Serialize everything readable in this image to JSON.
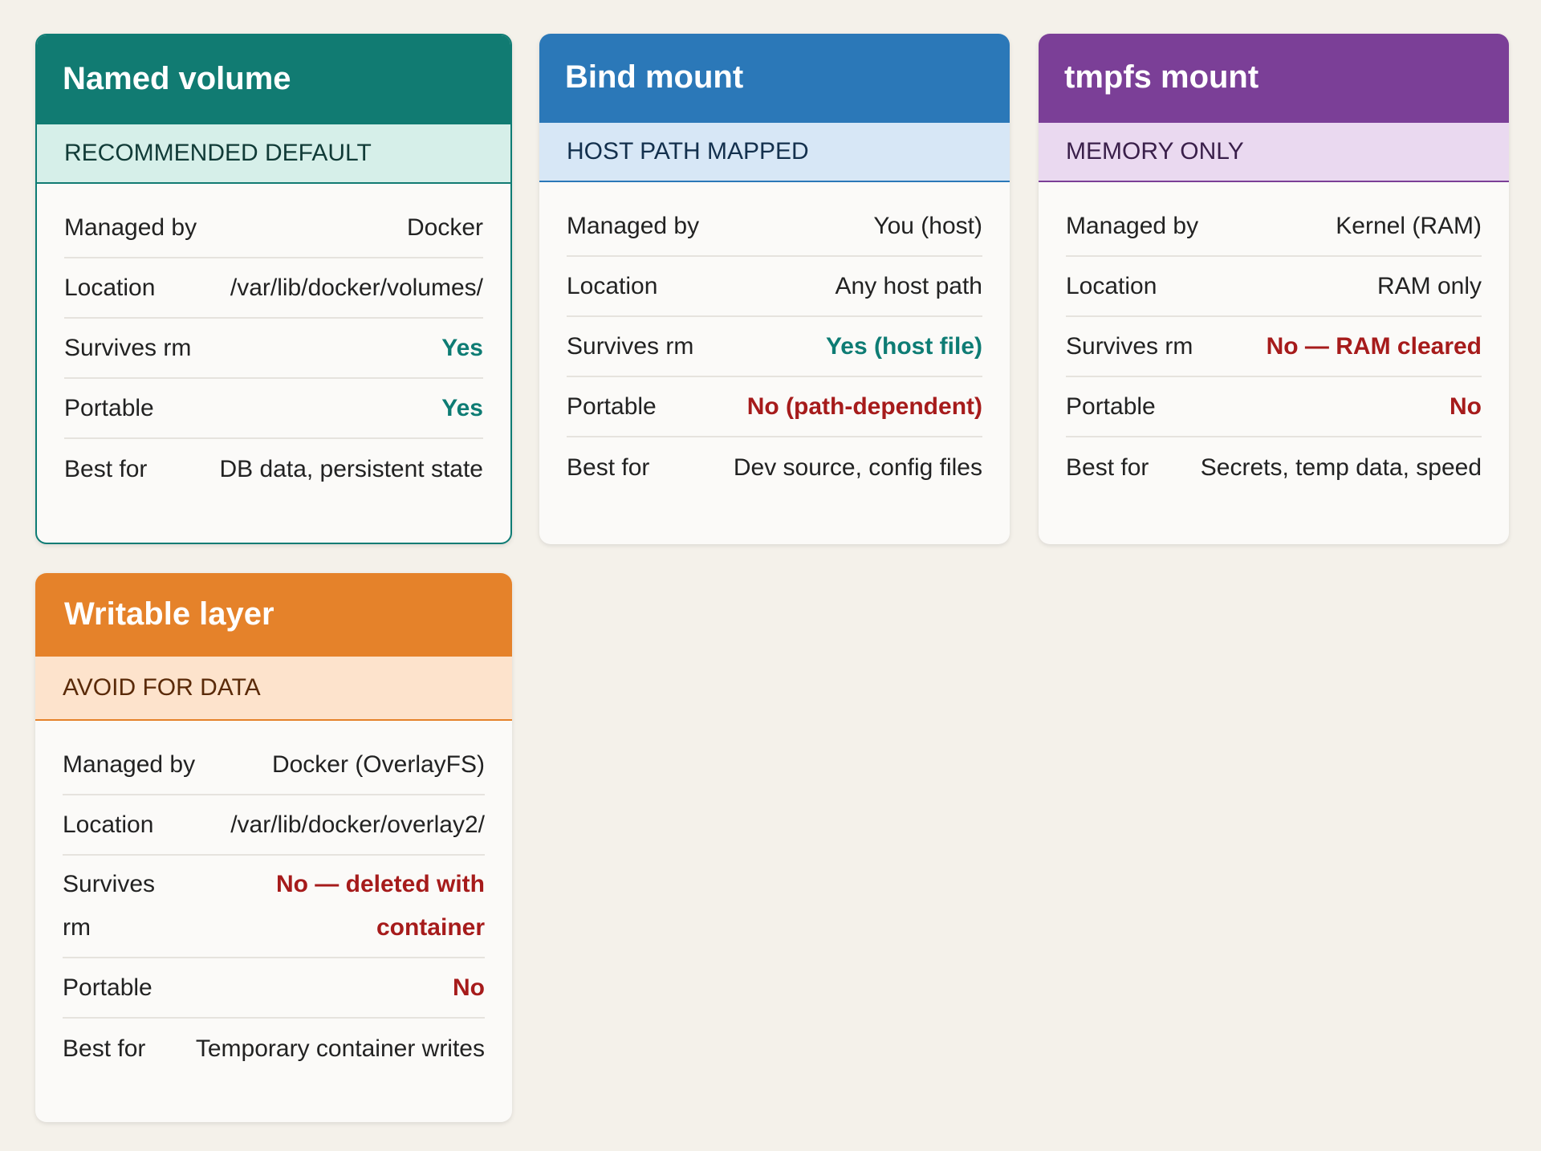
{
  "colors": {
    "background": "#f4f1ea",
    "good": "#0e7c74",
    "bad": "#a61b1b"
  },
  "cards": [
    {
      "id": "named-volume",
      "title": "Named volume",
      "tag": "RECOMMENDED DEFAULT",
      "header_color": "#117b72",
      "tag_bg": "#d6efe9",
      "tag_border": "#117b72",
      "tag_text_color": "#113b37",
      "rows": [
        {
          "label": "Managed by",
          "value": "Docker",
          "tone": "neutral"
        },
        {
          "label": "Location",
          "value": "/var/lib/docker/volumes/",
          "tone": "neutral"
        },
        {
          "label": "Survives rm",
          "value": "Yes",
          "tone": "good"
        },
        {
          "label": "Portable",
          "value": "Yes",
          "tone": "good"
        },
        {
          "label": "Best for",
          "value": "DB data, persistent state",
          "tone": "neutral"
        }
      ]
    },
    {
      "id": "bind-mount",
      "title": "Bind mount",
      "tag": "HOST PATH MAPPED",
      "header_color": "#2b78b8",
      "tag_bg": "#d7e7f6",
      "tag_border": "#2b78b8",
      "tag_text_color": "#13304d",
      "rows": [
        {
          "label": "Managed by",
          "value": "You (host)",
          "tone": "neutral"
        },
        {
          "label": "Location",
          "value": "Any host path",
          "tone": "neutral"
        },
        {
          "label": "Survives rm",
          "value": "Yes (host file)",
          "tone": "good"
        },
        {
          "label": "Portable",
          "value": "No (path-dependent)",
          "tone": "bad"
        },
        {
          "label": "Best for",
          "value": "Dev source, config files",
          "tone": "neutral"
        }
      ]
    },
    {
      "id": "tmpfs-mount",
      "title": "tmpfs mount",
      "tag": "MEMORY ONLY",
      "header_color": "#7b3f97",
      "tag_bg": "#ead9f0",
      "tag_border": "#7b3f97",
      "tag_text_color": "#3a1f4a",
      "rows": [
        {
          "label": "Managed by",
          "value": "Kernel (RAM)",
          "tone": "neutral"
        },
        {
          "label": "Location",
          "value": "RAM only",
          "tone": "neutral"
        },
        {
          "label": "Survives rm",
          "value": "No — RAM cleared",
          "tone": "bad"
        },
        {
          "label": "Portable",
          "value": "No",
          "tone": "bad"
        },
        {
          "label": "Best for",
          "value": "Secrets, temp data, speed",
          "tone": "neutral"
        }
      ]
    },
    {
      "id": "writable-layer",
      "title": "Writable layer",
      "tag": "AVOID FOR DATA",
      "header_color": "#e5822a",
      "tag_bg": "#fde3cc",
      "tag_border": "#e5822a",
      "tag_text_color": "#5a2a08",
      "rows": [
        {
          "label": "Managed by",
          "value": "Docker (OverlayFS)",
          "tone": "neutral"
        },
        {
          "label": "Location",
          "value": "/var/lib/docker/overlay2/",
          "tone": "neutral"
        },
        {
          "label": "Survives rm",
          "value": "No — deleted with container",
          "tone": "bad"
        },
        {
          "label": "Portable",
          "value": "No",
          "tone": "bad"
        },
        {
          "label": "Best for",
          "value": "Temporary container writes",
          "tone": "neutral"
        }
      ]
    }
  ]
}
